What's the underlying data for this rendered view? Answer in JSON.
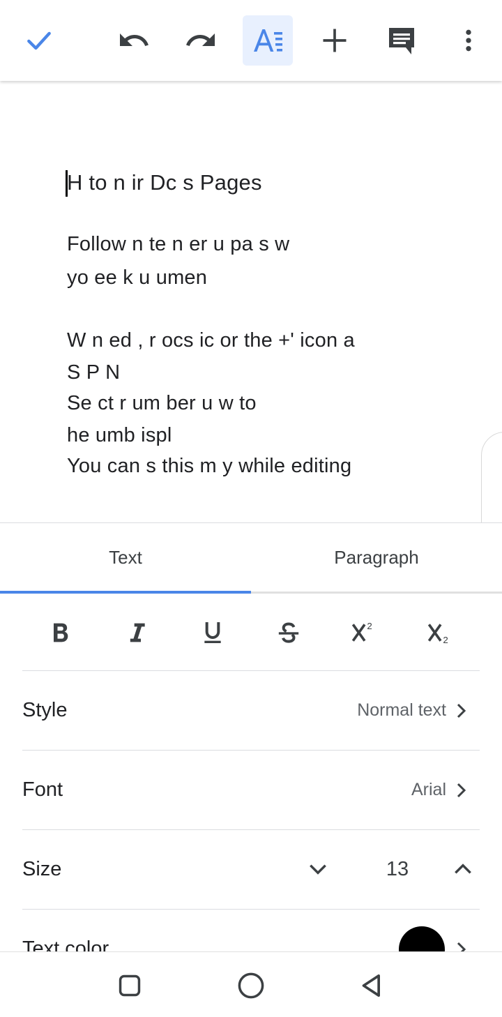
{
  "toolbar": {
    "icons": [
      "check-icon",
      "undo-icon",
      "redo-icon",
      "text-format-icon",
      "add-icon",
      "comment-icon",
      "more-vert-icon"
    ],
    "accent_color": "#4a86e8",
    "active_bg": "#e8f0fe"
  },
  "document": {
    "title_line": "H   to n   ir                Dc  s Pages",
    "lines": [
      "Follow  n         te       n        er   u   pa   s w",
      "yo   ee        k           u      umen",
      "W   n    ed        ,  r    ocs     ic  or  the  +' icon a",
      "S           P          N",
      "Se   ct     r        um  ber              u  w      to",
      " he             umb       ispl",
      "You can s               this m          y while editing"
    ]
  },
  "tabs": [
    {
      "label": "Text",
      "active": true
    },
    {
      "label": "Paragraph",
      "active": false
    }
  ],
  "format_buttons": [
    {
      "name": "bold-button",
      "label": "B"
    },
    {
      "name": "italic-button",
      "label": "I"
    },
    {
      "name": "underline-button",
      "label": "U"
    },
    {
      "name": "strikethrough-button",
      "label": "S"
    },
    {
      "name": "superscript-button",
      "label": "X²"
    },
    {
      "name": "subscript-button",
      "label": "X₂"
    }
  ],
  "settings": {
    "style": {
      "label": "Style",
      "value": "Normal text"
    },
    "font": {
      "label": "Font",
      "value": "Arial"
    },
    "size": {
      "label": "Size",
      "value": "13"
    },
    "text_color": {
      "label": "Text color",
      "swatch": "#000000"
    }
  },
  "navbar": {
    "icons": [
      "recents-square-icon",
      "home-circle-icon",
      "back-triangle-icon"
    ]
  }
}
